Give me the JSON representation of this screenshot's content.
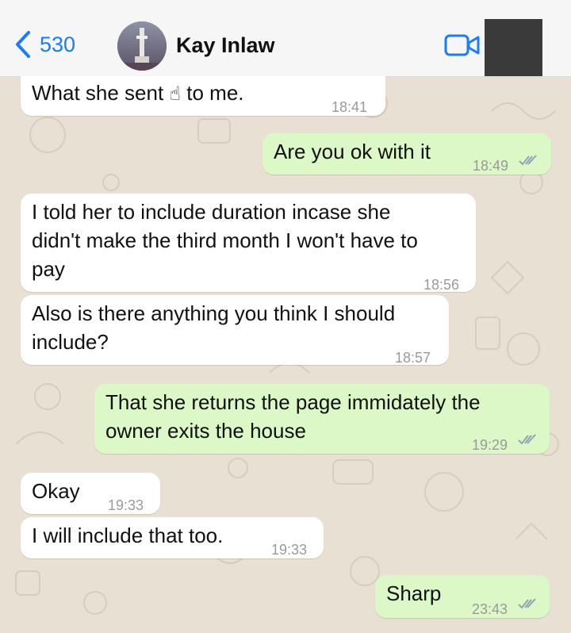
{
  "header": {
    "back_count": "530",
    "contact_name": "Kay Inlaw"
  },
  "messages": [
    {
      "direction": "in",
      "text": "What she sent ☝ to me.",
      "time": "18:41"
    },
    {
      "direction": "out",
      "text": "Are you ok with it",
      "time": "18:49",
      "read": true
    },
    {
      "direction": "in",
      "lines": [
        "I told her to include duration incase she",
        "didn't make the third month I won't have to",
        "pay"
      ],
      "time": "18:56"
    },
    {
      "direction": "in",
      "lines": [
        "Also is there anything you think I should",
        "include?"
      ],
      "time": "18:57"
    },
    {
      "direction": "out",
      "lines": [
        "That she returns the page immidately the",
        "owner exits the house"
      ],
      "time": "19:29",
      "read": true
    },
    {
      "direction": "in",
      "text": "Okay",
      "time": "19:33"
    },
    {
      "direction": "in",
      "text": "I will include that too.",
      "time": "19:33"
    },
    {
      "direction": "out",
      "text": "Sharp",
      "time": "23:43",
      "read": true
    }
  ],
  "colors": {
    "accent": "#1b7cf5",
    "incoming_bubble": "#ffffff",
    "outgoing_bubble": "#dcf8c6",
    "chat_background": "#e8e0d3"
  },
  "icons": [
    "chevron-left-icon",
    "video-call-icon",
    "double-check-icon",
    "pointing-up-emoji"
  ]
}
